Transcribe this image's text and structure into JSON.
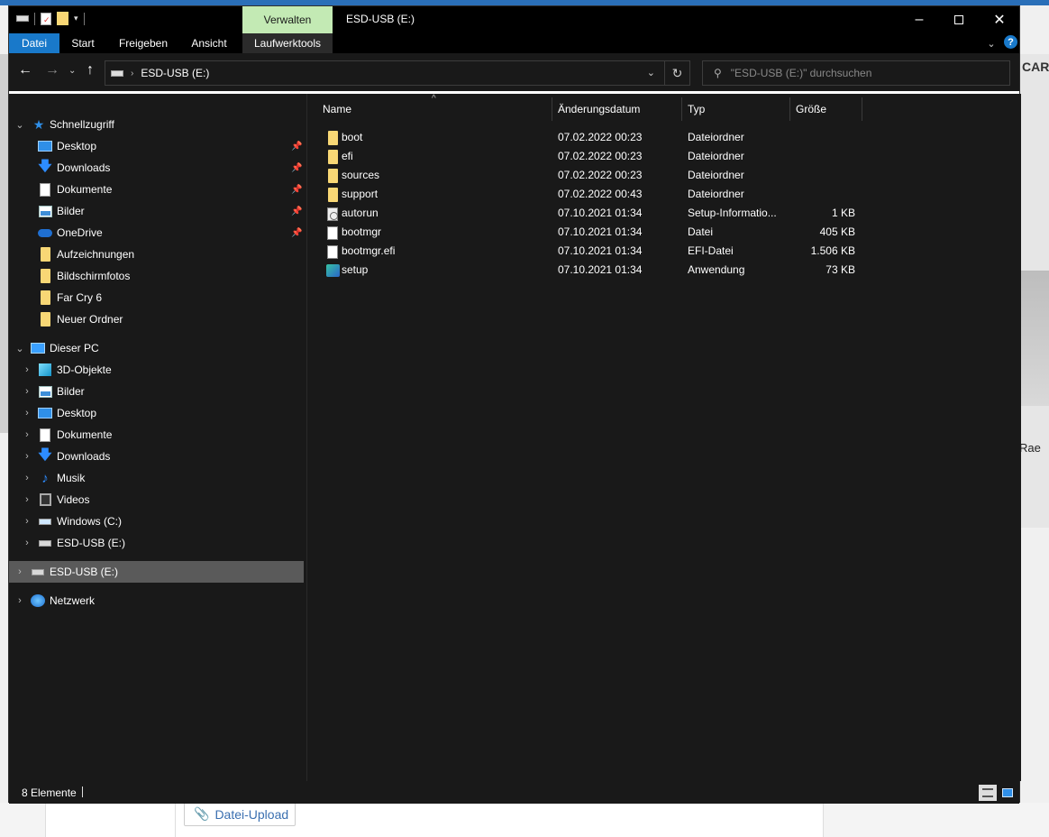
{
  "window": {
    "title": "ESD-USB (E:)",
    "contextual_tab": "Verwalten",
    "controls": {
      "minimize": "–",
      "maximize": "☐",
      "close": "✕"
    }
  },
  "ribbon": {
    "tabs": [
      "Datei",
      "Start",
      "Freigeben",
      "Ansicht",
      "Laufwerktools"
    ],
    "expand_icon": "chevron-down-icon",
    "help_label": "?"
  },
  "address": {
    "path": "ESD-USB (E:)",
    "search_placeholder": "\"ESD-USB (E:)\" durchsuchen"
  },
  "nav": {
    "quick_access": {
      "label": "Schnellzugriff",
      "items": [
        {
          "label": "Desktop",
          "icon": "desktop-icon",
          "pinned": true
        },
        {
          "label": "Downloads",
          "icon": "download-icon",
          "pinned": true
        },
        {
          "label": "Dokumente",
          "icon": "document-icon",
          "pinned": true
        },
        {
          "label": "Bilder",
          "icon": "pictures-icon",
          "pinned": true
        },
        {
          "label": "OneDrive",
          "icon": "onedrive-icon",
          "pinned": true
        },
        {
          "label": "Aufzeichnungen",
          "icon": "folder-icon",
          "pinned": false
        },
        {
          "label": "Bildschirmfotos",
          "icon": "folder-icon",
          "pinned": false
        },
        {
          "label": "Far Cry 6",
          "icon": "folder-icon",
          "pinned": false
        },
        {
          "label": "Neuer Ordner",
          "icon": "folder-icon",
          "pinned": false
        }
      ]
    },
    "this_pc": {
      "label": "Dieser PC",
      "items": [
        {
          "label": "3D-Objekte",
          "icon": "3d-objects-icon"
        },
        {
          "label": "Bilder",
          "icon": "pictures-icon"
        },
        {
          "label": "Desktop",
          "icon": "desktop-icon"
        },
        {
          "label": "Dokumente",
          "icon": "document-icon"
        },
        {
          "label": "Downloads",
          "icon": "download-icon"
        },
        {
          "label": "Musik",
          "icon": "music-icon"
        },
        {
          "label": "Videos",
          "icon": "videos-icon"
        },
        {
          "label": "Windows (C:)",
          "icon": "windows-drive-icon"
        },
        {
          "label": "ESD-USB (E:)",
          "icon": "usb-drive-icon"
        }
      ]
    },
    "usb_root": {
      "label": "ESD-USB (E:)"
    },
    "network": {
      "label": "Netzwerk"
    }
  },
  "columns": {
    "name": "Name",
    "date": "Änderungsdatum",
    "type": "Typ",
    "size": "Größe"
  },
  "files": [
    {
      "name": "boot",
      "date": "07.02.2022 00:23",
      "type": "Dateiordner",
      "size": "",
      "icon": "folder-icon"
    },
    {
      "name": "efi",
      "date": "07.02.2022 00:23",
      "type": "Dateiordner",
      "size": "",
      "icon": "folder-icon"
    },
    {
      "name": "sources",
      "date": "07.02.2022 00:23",
      "type": "Dateiordner",
      "size": "",
      "icon": "folder-icon"
    },
    {
      "name": "support",
      "date": "07.02.2022 00:43",
      "type": "Dateiordner",
      "size": "",
      "icon": "folder-icon"
    },
    {
      "name": "autorun",
      "date": "07.10.2021 01:34",
      "type": "Setup-Informatio...",
      "size": "1 KB",
      "icon": "setup-info-icon"
    },
    {
      "name": "bootmgr",
      "date": "07.10.2021 01:34",
      "type": "Datei",
      "size": "405 KB",
      "icon": "file-icon"
    },
    {
      "name": "bootmgr.efi",
      "date": "07.10.2021 01:34",
      "type": "EFI-Datei",
      "size": "1.506 KB",
      "icon": "file-icon"
    },
    {
      "name": "setup",
      "date": "07.10.2021 01:34",
      "type": "Anwendung",
      "size": "73 KB",
      "icon": "application-icon"
    }
  ],
  "status": {
    "count": "8 Elemente"
  },
  "background": {
    "logo_text": "CAR",
    "side_text": "Rae",
    "upload_label": "Datei-Upload"
  }
}
